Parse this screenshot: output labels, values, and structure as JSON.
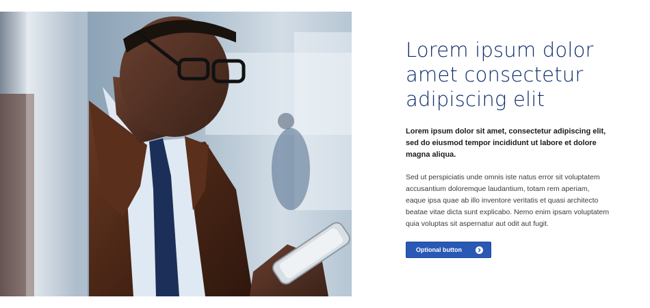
{
  "hero": {
    "image_icon": "photo-man-reading-phone-in-train"
  },
  "content": {
    "headline": "Lorem ipsum dolor amet consectetur adipiscing elit",
    "lead": "Lorem ipsum dolor sit amet, consectetur adipiscing elit, sed do eiusmod tempor incididunt ut labore et dolore magna aliqua.",
    "body": "Sed ut perspiciatis unde omnis iste natus error sit voluptatem accusantium doloremque laudantium, totam rem aperiam, eaque ipsa quae ab illo inventore veritatis et quasi architecto beatae vitae dicta sunt explicabo. Nemo enim ipsam voluptatem quia voluptas sit aspernatur aut odit aut fugit.",
    "button_label": "Optional button",
    "button_icon": "arrow-right-circle-icon"
  },
  "colors": {
    "headline": "#0d2a6b",
    "button": "#2a59b5"
  }
}
